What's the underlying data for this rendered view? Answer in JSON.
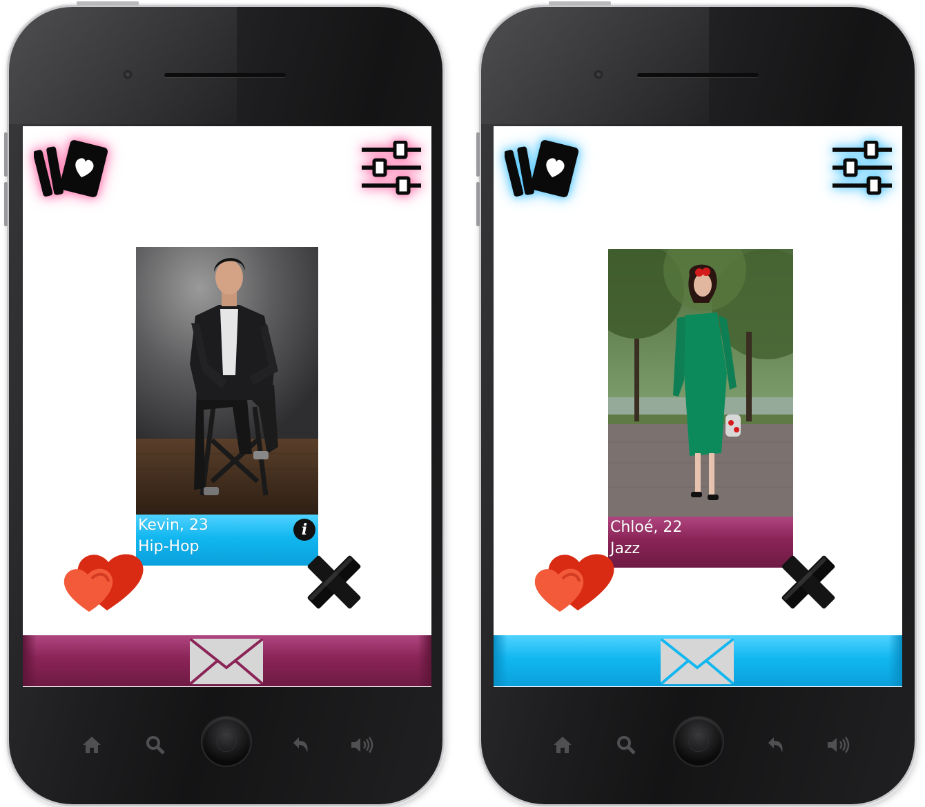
{
  "theme": {
    "pink_glow": "#ff8fc0",
    "blue_glow": "#59c9ff",
    "accent_blue": "#12b7f0",
    "accent_plum": "#8a2457",
    "hearts_red": "#d92b13",
    "hearts_orange": "#f25a3a"
  },
  "phones": [
    {
      "top_icons_glow": "pink",
      "profile": {
        "name_age": "Kevin, 23",
        "music": "Hip-Hop",
        "info_icon": "i",
        "bar_color": "#12b7f0",
        "photo": "man in black leather jacket seated on a stool"
      },
      "message_bar_color": "#8a2457"
    },
    {
      "top_icons_glow": "blue",
      "profile": {
        "name_age": "Chloé, 22",
        "music": "Jazz",
        "bar_color": "#8a2457",
        "photo": "woman in green dress walking in a park"
      },
      "message_bar_color": "#12b7f0"
    }
  ],
  "icons": [
    "cards-icon",
    "filter-sliders-icon",
    "hearts-icon",
    "close-x-icon",
    "envelope-icon",
    "home-icon",
    "search-icon",
    "back-icon",
    "volume-icon"
  ]
}
